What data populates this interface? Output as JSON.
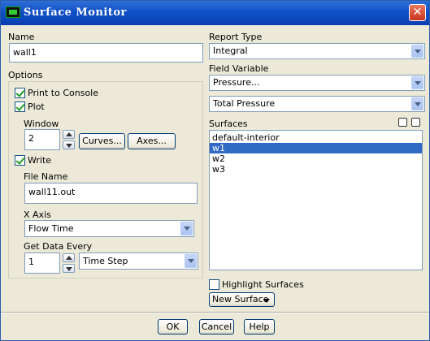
{
  "window": {
    "title": "Surface Monitor",
    "close_glyph": "✕"
  },
  "name": {
    "label": "Name",
    "value": "wall1"
  },
  "options": {
    "label": "Options",
    "print_to_console": {
      "label": "Print to Console",
      "checked": true
    },
    "plot": {
      "label": "Plot",
      "checked": true
    },
    "window_label": "Window",
    "window_value": "2",
    "curves_button": "Curves...",
    "axes_button": "Axes...",
    "write": {
      "label": "Write",
      "checked": true
    },
    "file_name_label": "File Name",
    "file_name_value": "wall11.out",
    "x_axis_label": "X Axis",
    "x_axis_value": "Flow Time",
    "get_data_every_label": "Get Data Every",
    "get_data_every_value": "1",
    "get_data_every_unit": "Time Step"
  },
  "report_type": {
    "label": "Report Type",
    "value": "Integral"
  },
  "field_variable": {
    "label": "Field Variable",
    "category": "Pressure...",
    "value": "Total Pressure"
  },
  "surfaces": {
    "label": "Surfaces",
    "items": [
      {
        "label": "default-interior",
        "selected": false
      },
      {
        "label": "w1",
        "selected": true
      },
      {
        "label": "w2",
        "selected": false
      },
      {
        "label": "w3",
        "selected": false
      }
    ],
    "highlight_label": "Highlight Surfaces",
    "new_surface_label": "New Surface"
  },
  "footer": {
    "ok": "OK",
    "cancel": "Cancel",
    "help": "Help"
  }
}
